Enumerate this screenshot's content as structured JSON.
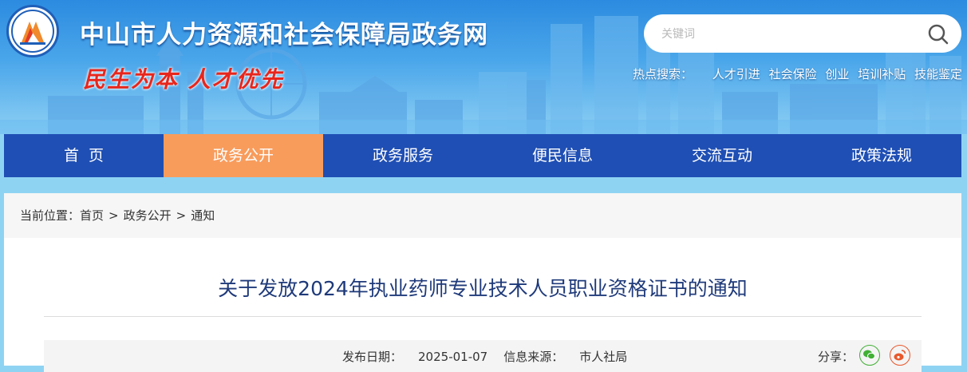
{
  "header": {
    "site_title": "中山市人力资源和社会保障局政务网",
    "slogan": "民生为本 人才优先",
    "logo_icon": "bureau-emblem-icon"
  },
  "search": {
    "placeholder": "关键词",
    "icon": "search-icon"
  },
  "hot_search": {
    "label": "热点搜索：",
    "keywords": [
      "人才引进",
      "社会保险",
      "创业",
      "培训补贴",
      "技能鉴定"
    ]
  },
  "nav": {
    "items": [
      {
        "label": "首  页"
      },
      {
        "label": "政务公开"
      },
      {
        "label": "政务服务"
      },
      {
        "label": "便民信息"
      },
      {
        "label": "交流互动"
      },
      {
        "label": "政策法规"
      }
    ],
    "active_index": 1
  },
  "breadcrumb": {
    "prefix": "当前位置：",
    "items": [
      "首页",
      "政务公开",
      "通知"
    ],
    "separator": ">"
  },
  "article": {
    "title": "关于发放2024年执业药师专业技术人员职业资格证书的通知",
    "publish_date_label": "发布日期：",
    "publish_date": "2025-01-07",
    "source_label": "信息来源：",
    "source": "市人社局",
    "share_label": "分享："
  },
  "colors": {
    "nav_bg": "#1f4fb4",
    "nav_active": "#f89c5c",
    "title_color": "#1f3a7a",
    "slogan_red": "#e8261c"
  }
}
